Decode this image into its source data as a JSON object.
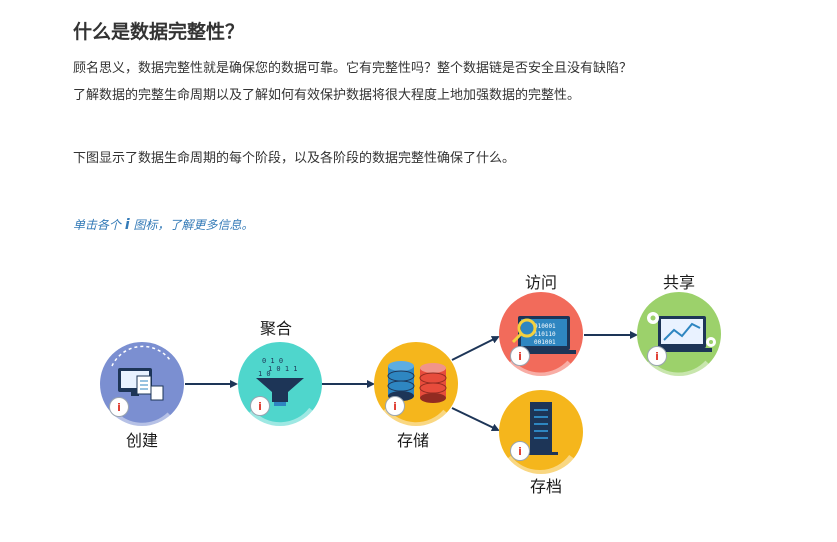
{
  "title": "什么是数据完整性？",
  "paragraphs": {
    "p1_line1": "顾名思义，数据完整性就是确保您的数据可靠。它有完整性吗？整个数据链是否安全且没有缺陷？",
    "p1_line2": "了解数据的完整生命周期以及了解如何有效保护数据将很大程度上地加强数据的完整性。",
    "p2": "下图显示了数据生命周期的每个阶段，以及各阶段的数据完整性确保了什么。"
  },
  "hint": {
    "prefix": "单击各个 ",
    "glyph": "i",
    "suffix": " 图标，了解更多信息。"
  },
  "diagram": {
    "info_letter": "i",
    "stages": {
      "create": {
        "label": "创建",
        "color": "#7b8fd1",
        "icon": "document-transfer-icon"
      },
      "aggregate": {
        "label": "聚合",
        "color": "#4fd6cc",
        "icon": "data-funnel-icon"
      },
      "store": {
        "label": "存储",
        "color": "#f5b61c",
        "icon": "database-stack-icon"
      },
      "access": {
        "label": "访问",
        "color": "#f26b5b",
        "icon": "magnify-binary-icon"
      },
      "share": {
        "label": "共享",
        "color": "#9cd16b",
        "icon": "chart-gear-icon"
      },
      "archive": {
        "label": "存档",
        "color": "#f5b61c",
        "icon": "server-rack-icon"
      }
    }
  }
}
